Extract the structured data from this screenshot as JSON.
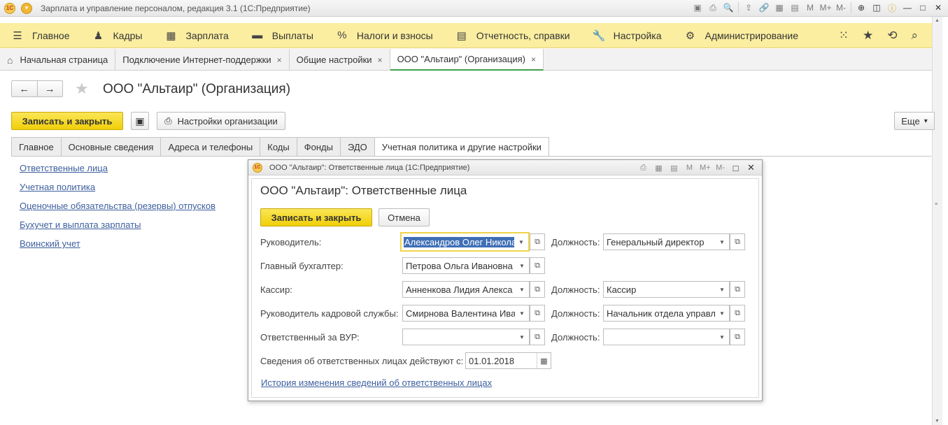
{
  "window": {
    "title": "Зарплата и управление персоналом, редакция 3.1  (1С:Предприятие)"
  },
  "menu": [
    {
      "icon": "hamburger-icon",
      "glyph": "☰",
      "label": "Главное"
    },
    {
      "icon": "people-icon",
      "glyph": "♟",
      "label": "Кадры"
    },
    {
      "icon": "calculator-icon",
      "glyph": "▦",
      "label": "Зарплата"
    },
    {
      "icon": "wallet-icon",
      "glyph": "▬",
      "label": "Выплаты"
    },
    {
      "icon": "percent-icon",
      "glyph": "%",
      "label": "Налоги и взносы"
    },
    {
      "icon": "reports-icon",
      "glyph": "▤",
      "label": "Отчетность, справки"
    },
    {
      "icon": "wrench-icon",
      "glyph": "🔧",
      "label": "Настройка"
    },
    {
      "icon": "gear-icon",
      "glyph": "⚙",
      "label": "Администрирование"
    }
  ],
  "page_tabs": [
    {
      "label": "Начальная страница",
      "home": true
    },
    {
      "label": "Подключение Интернет-поддержки",
      "close": "×"
    },
    {
      "label": "Общие настройки",
      "close": "×"
    },
    {
      "label": "ООО \"Альтаир\" (Организация)",
      "close": "×",
      "active": true
    }
  ],
  "form": {
    "title": "ООО \"Альтаир\" (Организация)",
    "save_close": "Записать и закрыть",
    "org_settings": "Настройки организации",
    "more": "Еще",
    "more_arrow": "▾",
    "tabs": [
      "Главное",
      "Основные сведения",
      "Адреса и телефоны",
      "Коды",
      "Фонды",
      "ЭДО",
      "Учетная политика и другие настройки"
    ],
    "links": [
      "Ответственные лица",
      "Учетная политика",
      "Оценочные обязательства (резервы) отпусков",
      "Бухучет и выплата зарплаты",
      "Воинский учет"
    ]
  },
  "dialog": {
    "window_title": "ООО \"Альтаир\": Ответственные лица  (1С:Предприятие)",
    "tool_m": "M",
    "tool_mplus": "M+",
    "tool_mminus": "M-",
    "heading": "ООО \"Альтаир\": Ответственные лица",
    "save_close": "Записать и закрыть",
    "cancel": "Отмена",
    "position_label": "Должность:",
    "rows": {
      "head": {
        "label": "Руководитель:",
        "value": "Александров Олег Никола",
        "position": "Генеральный директор"
      },
      "accountant": {
        "label": "Главный бухгалтер:",
        "value": "Петрова Ольга Ивановна"
      },
      "cashier": {
        "label": "Кассир:",
        "value": "Анненкова Лидия Алекса",
        "position": "Кассир"
      },
      "hr": {
        "label": "Руководитель кадровой службы:",
        "value": "Смирнова Валентина Ива",
        "position": "Начальник отдела управл"
      },
      "military": {
        "label": "Ответственный за ВУР:",
        "value": "",
        "position": ""
      }
    },
    "valid_from_label": "Сведения об ответственных лицах действуют с:",
    "valid_from": "01.01.2018",
    "history_link": "История изменения сведений об ответственных лицах"
  }
}
